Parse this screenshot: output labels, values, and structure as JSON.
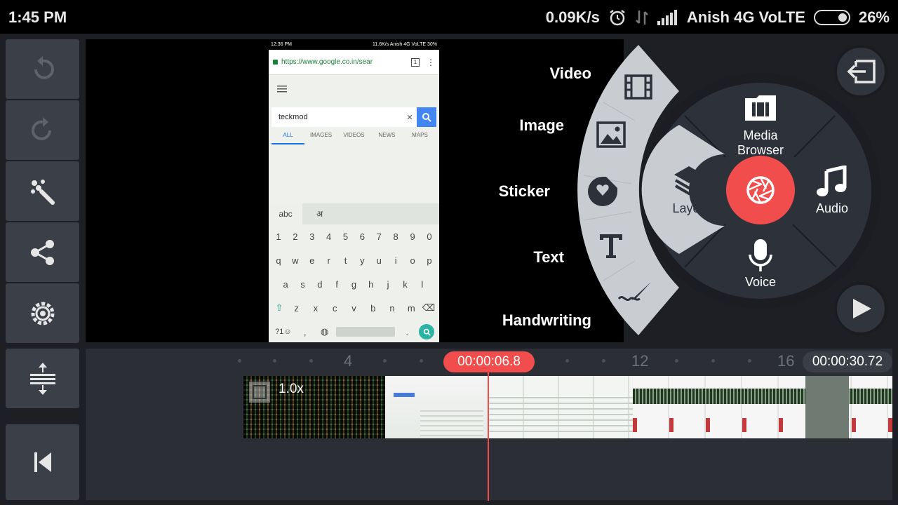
{
  "status_bar": {
    "time": "1:45 PM",
    "net_speed": "0.09K/s",
    "carrier": "Anish 4G VoLTE",
    "battery": "26%"
  },
  "toolbar": {
    "items": [
      {
        "name": "undo",
        "icon": "undo-icon"
      },
      {
        "name": "redo",
        "icon": "redo-icon"
      },
      {
        "name": "effects",
        "icon": "magic-wand-icon"
      },
      {
        "name": "share",
        "icon": "share-icon"
      },
      {
        "name": "settings",
        "icon": "gear-icon"
      },
      {
        "name": "timeline-expand",
        "icon": "expand-vertical-icon"
      },
      {
        "name": "jump-to-start",
        "icon": "skip-to-start-icon"
      }
    ]
  },
  "preview": {
    "phone_status": {
      "time": "12:36 PM",
      "net": "11.6K/s",
      "carrier": "Anish 4G VoLTE",
      "battery": "30%"
    },
    "url": "https://www.google.co.in/sear",
    "tab_count": "1",
    "search_query": "teckmod",
    "search_tabs": [
      "ALL",
      "IMAGES",
      "VIDEOS",
      "NEWS",
      "MAPS"
    ],
    "keyboard": {
      "lang_left": "abc",
      "lang_right": "अ",
      "rows": [
        [
          "1",
          "2",
          "3",
          "4",
          "5",
          "6",
          "7",
          "8",
          "9",
          "0"
        ],
        [
          "q",
          "w",
          "e",
          "r",
          "t",
          "y",
          "u",
          "i",
          "o",
          "p"
        ],
        [
          "a",
          "s",
          "d",
          "f",
          "g",
          "h",
          "j",
          "k",
          "l"
        ],
        [
          "z",
          "x",
          "c",
          "v",
          "b",
          "n",
          "m"
        ]
      ],
      "symbols_key": "?1☺",
      "comma_key": ",",
      "period_key": "."
    }
  },
  "media_menu": {
    "categories": [
      "Video",
      "Image",
      "Sticker",
      "Text",
      "Handwriting"
    ],
    "media_browser": "Media Browser",
    "layer": "Layer",
    "audio": "Audio",
    "voice": "Voice",
    "record_color": "#f24d4d"
  },
  "timeline": {
    "current_time": "00:00:06.8",
    "total_time": "00:00:30.72",
    "ruler_labels": [
      "4",
      "12",
      "16"
    ],
    "clip_speed": "1.0x"
  },
  "colors": {
    "accent": "#f24d4d",
    "panel": "#3a3f48",
    "background": "#1d1f24"
  }
}
